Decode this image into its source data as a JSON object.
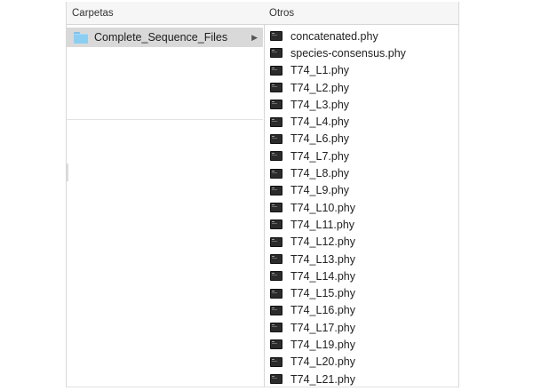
{
  "columns": {
    "left_header": "Carpetas",
    "right_header": "Otros"
  },
  "folders": [
    {
      "label": "Complete_Sequence_Files",
      "selected": true,
      "icon": "folder-icon",
      "expand_icon": "chevron-right-icon"
    }
  ],
  "files": [
    "concatenated.phy",
    "species-consensus.phy",
    "T74_L1.phy",
    "T74_L2.phy",
    "T74_L3.phy",
    "T74_L4.phy",
    "T74_L6.phy",
    "T74_L7.phy",
    "T74_L8.phy",
    "T74_L9.phy",
    "T74_L10.phy",
    "T74_L11.phy",
    "T74_L12.phy",
    "T74_L13.phy",
    "T74_L14.phy",
    "T74_L15.phy",
    "T74_L16.phy",
    "T74_L17.phy",
    "T74_L19.phy",
    "T74_L20.phy",
    "T74_L21.phy"
  ],
  "file_icon": "terminal-document-icon",
  "colors": {
    "selection": "#d9d9d9",
    "folder": "#8ccdf2",
    "header_bg": "#f6f6f6"
  }
}
